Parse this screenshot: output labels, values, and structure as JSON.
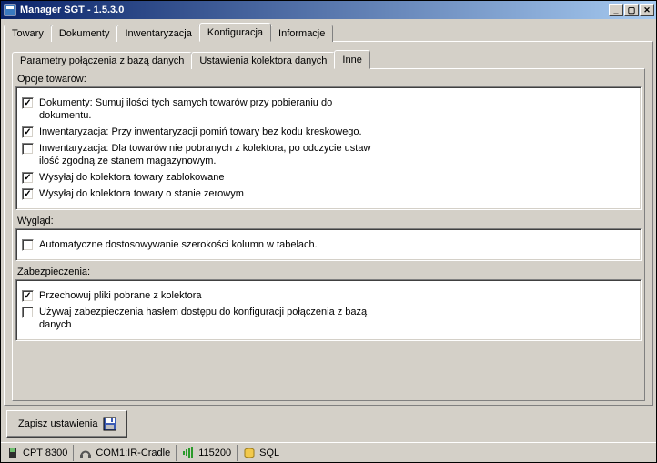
{
  "titlebar": {
    "title": "Manager SGT - 1.5.3.0"
  },
  "tabs": {
    "towary": "Towary",
    "dokumenty": "Dokumenty",
    "inwentaryzacja": "Inwentaryzacja",
    "konfiguracja": "Konfiguracja",
    "informacje": "Informacje"
  },
  "subtabs": {
    "parametry": "Parametry połączenia z bazą danych",
    "ustawienia": "Ustawienia kolektora danych",
    "inne": "Inne"
  },
  "groups": {
    "opcje": {
      "label": "Opcje towarów:",
      "items": [
        {
          "checked": true,
          "text": "Dokumenty: Sumuj ilości tych samych towarów przy pobieraniu do dokumentu."
        },
        {
          "checked": true,
          "text": "Inwentaryzacja: Przy inwentaryzacji pomiń towary bez kodu kreskowego."
        },
        {
          "checked": false,
          "text": "Inwentaryzacja: Dla towarów nie pobranych z kolektora, po odczycie ustaw ilość zgodną ze stanem magazynowym."
        },
        {
          "checked": true,
          "text": "Wysyłaj do kolektora towary zablokowane"
        },
        {
          "checked": true,
          "text": "Wysyłaj do kolektora towary o stanie zerowym"
        }
      ]
    },
    "wyglad": {
      "label": "Wygląd:",
      "items": [
        {
          "checked": false,
          "text": "Automatyczne dostosowywanie szerokości kolumn w tabelach."
        }
      ]
    },
    "zabezpieczenia": {
      "label": "Zabezpieczenia:",
      "items": [
        {
          "checked": true,
          "text": "Przechowuj pliki pobrane z kolektora"
        },
        {
          "checked": false,
          "text": "Używaj zabezpieczenia hasłem dostępu do konfiguracji połączenia z bazą danych"
        }
      ]
    }
  },
  "buttons": {
    "save": "Zapisz ustawienia"
  },
  "status": {
    "device": "CPT 8300",
    "port": "COM1:IR-Cradle",
    "speed": "115200",
    "db": "SQL"
  }
}
